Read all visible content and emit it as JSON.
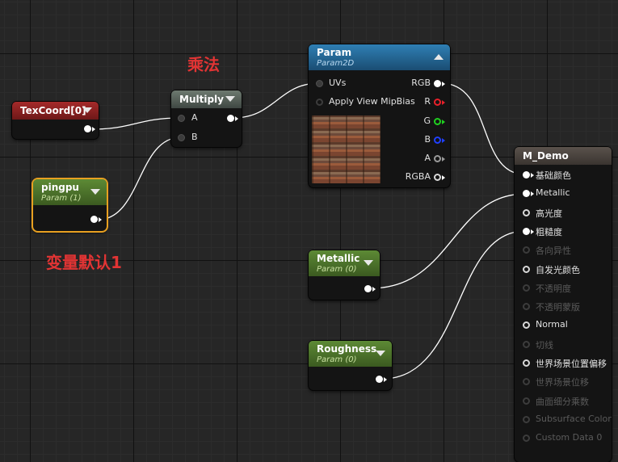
{
  "captions": {
    "multiply_note": "乘法",
    "default_note": "变量默认1"
  },
  "colors": {
    "accent_red": "#e23434",
    "header_red": "#a52a2a",
    "header_green": "#5d8a35",
    "header_blue": "#2f7fb4",
    "header_gray": "#6e7a70",
    "pin_r": "#e8202a",
    "pin_g": "#20d020",
    "pin_b": "#2040ff",
    "wire": "#ffffff"
  },
  "nodes": {
    "texcoord": {
      "title": "TexCoord[0]",
      "icons": [
        "chevron-down-icon",
        "output-pin-icon"
      ]
    },
    "pingpu": {
      "title": "pingpu",
      "subtitle": "Param (1)"
    },
    "multiply": {
      "title": "Multiply",
      "inputs": [
        "A",
        "B"
      ]
    },
    "param": {
      "title": "Param",
      "subtitle": "Param2D",
      "inputs": [
        "UVs",
        "Apply View MipBias"
      ],
      "outputs": [
        "RGB",
        "R",
        "G",
        "B",
        "A",
        "RGBA"
      ]
    },
    "metallic": {
      "title": "Metallic",
      "subtitle": "Param (0)"
    },
    "roughness": {
      "title": "Roughness",
      "subtitle": "Param (0)"
    },
    "material": {
      "title": "M_Demo",
      "inputs": [
        {
          "label": "基础颜色",
          "active": true
        },
        {
          "label": "Metallic",
          "active": true
        },
        {
          "label": "高光度",
          "active": true
        },
        {
          "label": "粗糙度",
          "active": true
        },
        {
          "label": "各向异性",
          "active": false
        },
        {
          "label": "自发光颜色",
          "active": true
        },
        {
          "label": "不透明度",
          "active": false
        },
        {
          "label": "不透明蒙版",
          "active": false
        },
        {
          "label": "Normal",
          "active": true
        },
        {
          "label": "切线",
          "active": false
        },
        {
          "label": "世界场景位置偏移",
          "active": true
        },
        {
          "label": "世界场景位移",
          "active": false
        },
        {
          "label": "曲面细分乘数",
          "active": false
        },
        {
          "label": "Subsurface Color",
          "active": false
        },
        {
          "label": "Custom Data 0",
          "active": false
        }
      ]
    }
  }
}
